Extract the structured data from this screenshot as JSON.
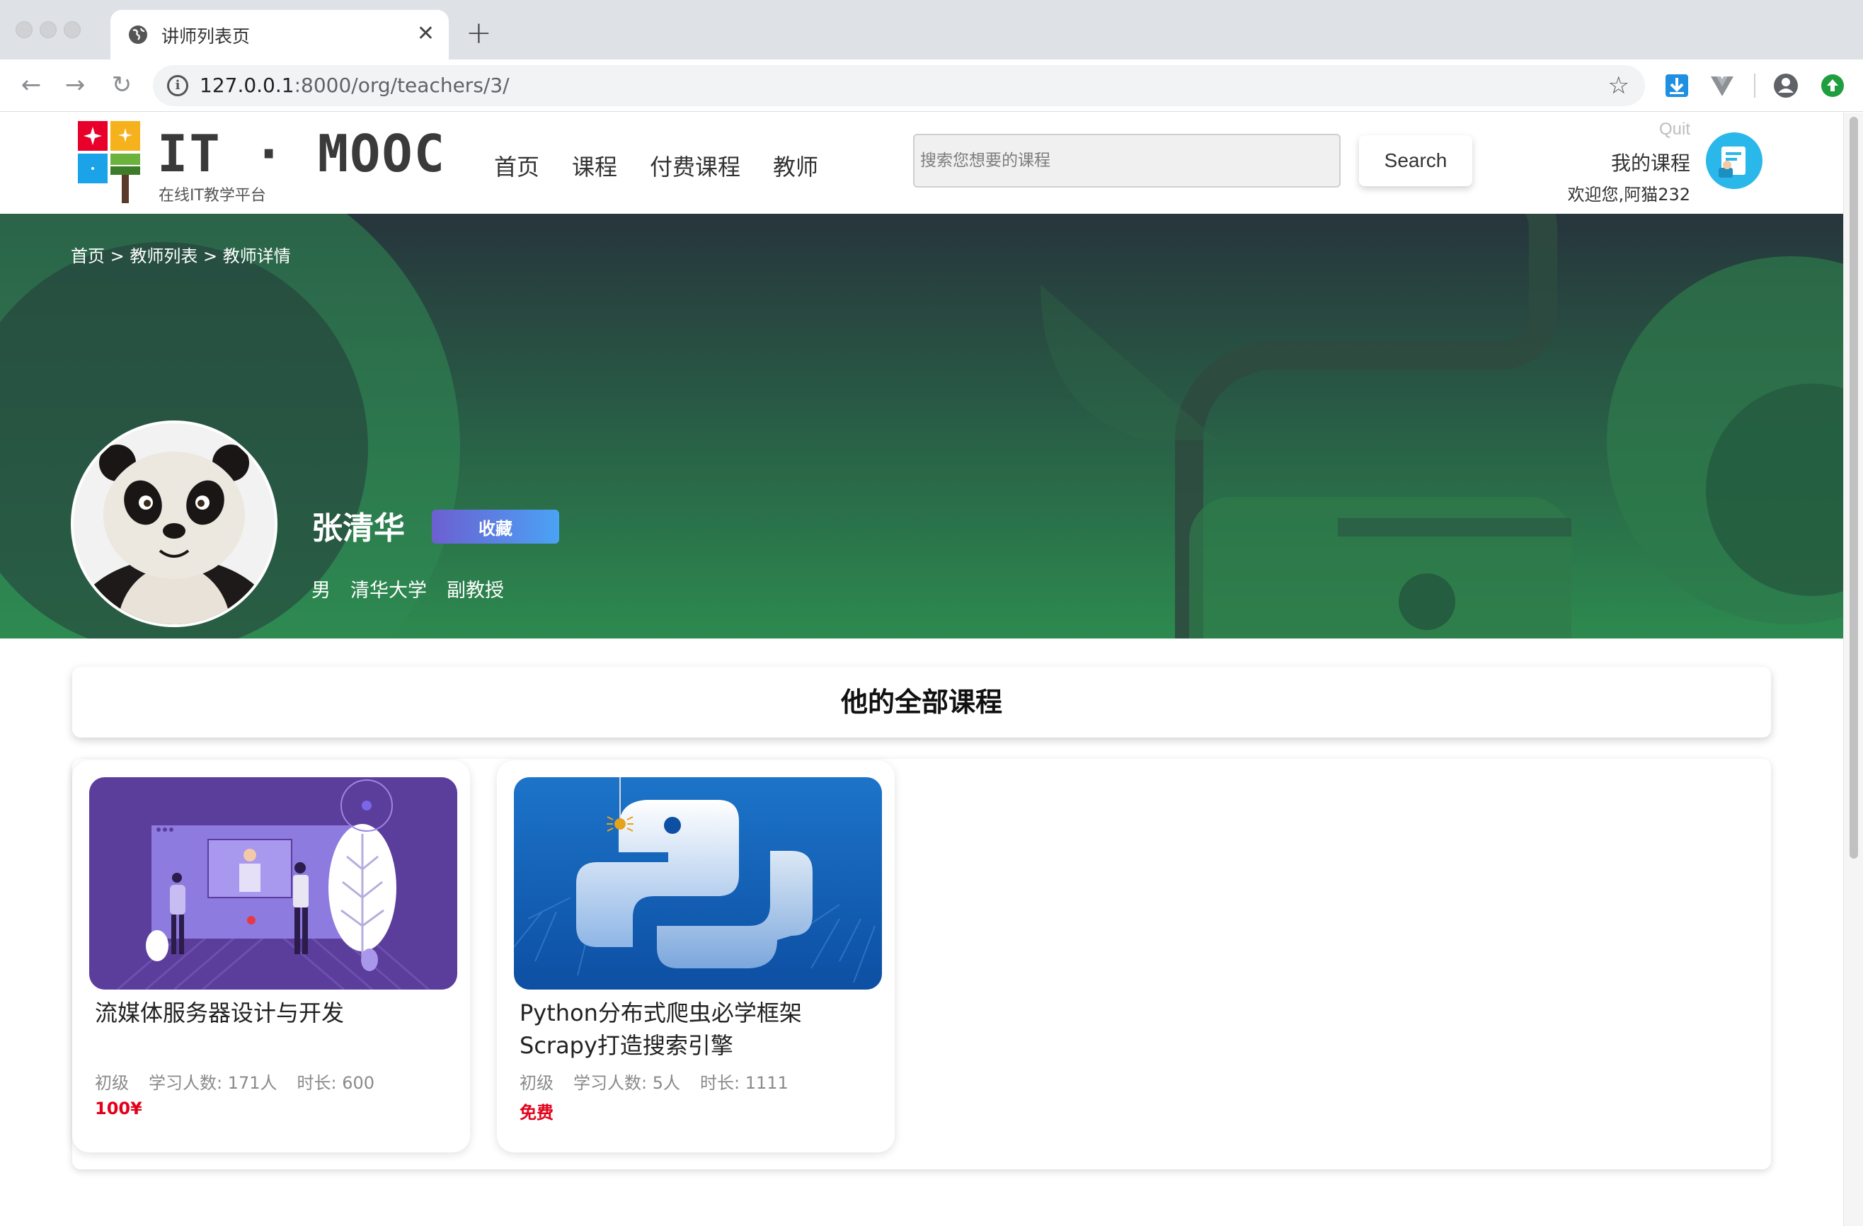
{
  "browser": {
    "tab_title": "讲师列表页",
    "url_host": "127.0.0.1",
    "url_rest": ":8000/org/teachers/3/"
  },
  "header": {
    "logo_text": "IT · MOOC",
    "logo_sub": "在线IT教学平台",
    "nav": [
      "首页",
      "课程",
      "付费课程",
      "教师"
    ],
    "search_placeholder": "搜索您想要的课程",
    "search_button": "Search",
    "quit": "Quit",
    "my_courses": "我的课程",
    "welcome": "欢迎您,阿猫232"
  },
  "banner": {
    "breadcrumb": [
      "首页",
      ">",
      "教师列表",
      ">",
      "教师详情"
    ],
    "teacher_name": "张清华",
    "favorite_button": "收藏",
    "gender": "男",
    "university": "清华大学",
    "title": "副教授"
  },
  "section_title": "他的全部课程",
  "courses": [
    {
      "title": "流媒体服务器设计与开发",
      "level": "初级",
      "students": "学习人数: 171人",
      "duration": "时长: 600",
      "price": "100¥"
    },
    {
      "title": "Python分布式爬虫必学框架Scrapy打造搜索引擎",
      "level": "初级",
      "students": "学习人数: 5人",
      "duration": "时长: 1111",
      "price": "免费"
    }
  ],
  "colors": {
    "price": "#e4001a",
    "banner_dark": "#27353c",
    "banner_green": "#2d8a4f",
    "favorite_gradient": [
      "#6c5fd1",
      "#4aa3f5"
    ]
  }
}
